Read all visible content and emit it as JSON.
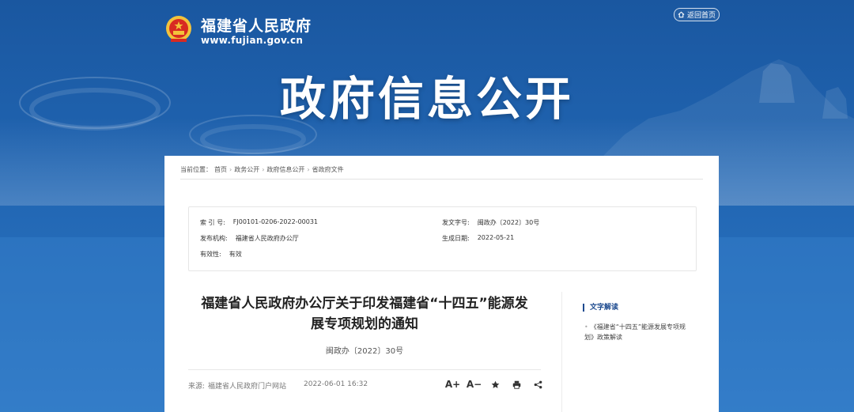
{
  "header": {
    "site_name": "福建省人民政府",
    "site_url": "www.fujian.gov.cn",
    "back_home": "返回首页",
    "banner_title": "政府信息公开"
  },
  "breadcrumb": {
    "prefix": "当前位置：",
    "items": [
      "首页",
      "政务公开",
      "政府信息公开",
      "省政府文件"
    ],
    "separator": "›"
  },
  "meta": {
    "index_no_label": "索 引 号:",
    "index_no": "FJ00101-0206-2022-00031",
    "doc_no_label": "发文字号:",
    "doc_no": "闽政办〔2022〕30号",
    "publisher_label": "发布机构:",
    "publisher": "福建省人民政府办公厅",
    "date_label": "生成日期:",
    "date": "2022-05-21",
    "validity_label": "有效性:",
    "validity": "有效"
  },
  "article": {
    "title_line1": "福建省人民政府办公厅关于印发福建省“十四五”能源发",
    "title_line2": "展专项规划的通知",
    "number": "闽政办〔2022〕30号",
    "source_label": "来源:",
    "source": "福建省人民政府门户网站",
    "published": "2022-06-01 16:32",
    "tools": {
      "font_increase": "A+",
      "font_decrease": "A−"
    }
  },
  "sidebar": {
    "title": "文字解读",
    "items": [
      "《福建省“十四五”能源发展专项规划》政策解读"
    ]
  },
  "colors": {
    "banner": "#1d5ea7",
    "accent": "#1c4a8f"
  }
}
